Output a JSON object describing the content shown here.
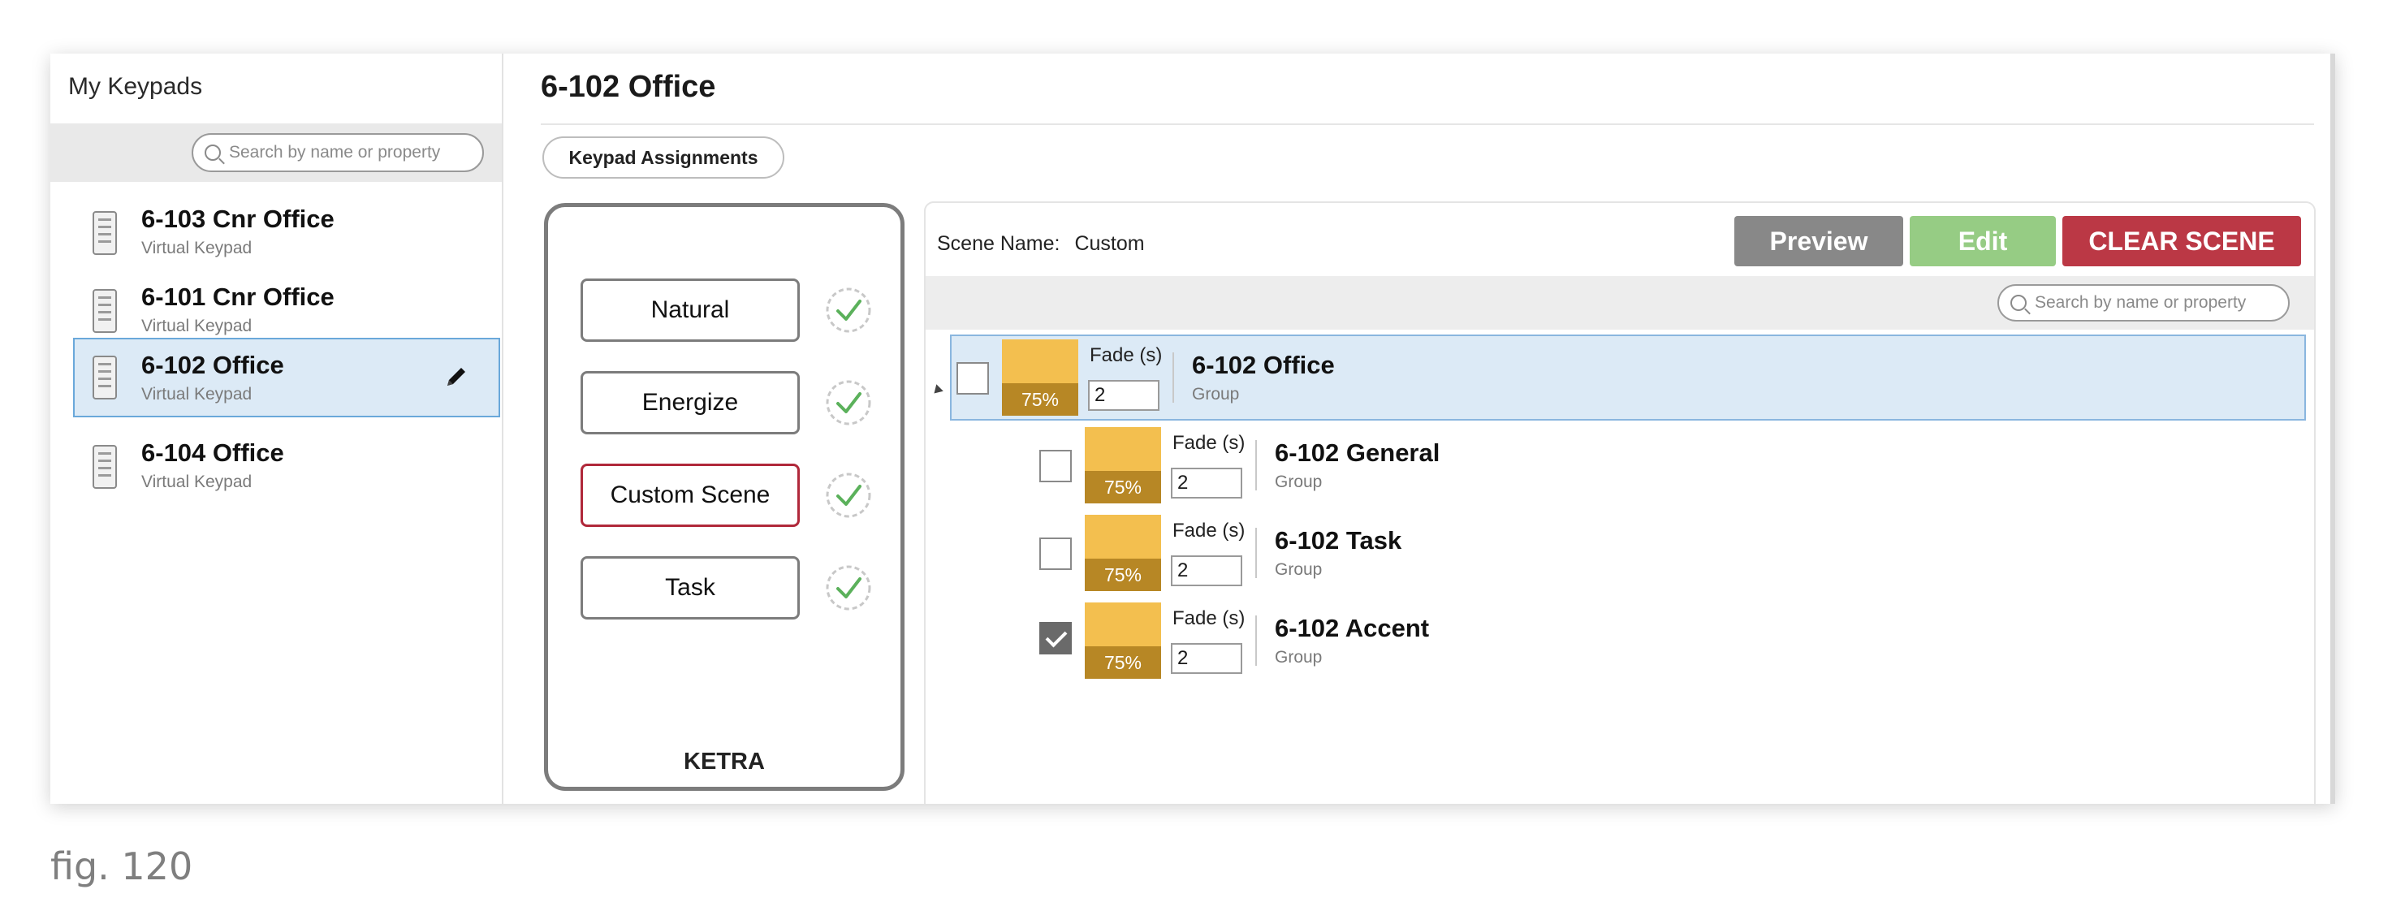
{
  "sidebar": {
    "title": "My Keypads",
    "search_placeholder": "Search by name or property",
    "items": [
      {
        "name": "6-103 Cnr Office",
        "type": "Virtual Keypad"
      },
      {
        "name": "6-101 Cnr Office",
        "type": "Virtual Keypad"
      },
      {
        "name": "6-102 Office",
        "type": "Virtual Keypad"
      },
      {
        "name": "6-104 Office",
        "type": "Virtual Keypad"
      }
    ]
  },
  "main": {
    "title": "6-102 Office",
    "assignments_button": "Keypad Assignments"
  },
  "keypad": {
    "buttons": [
      "Natural",
      "Energize",
      "Custom Scene",
      "Task"
    ],
    "brand": "KETRA"
  },
  "scene": {
    "name_label": "Scene Name:",
    "name_value": "Custom",
    "preview_label": "Preview",
    "edit_label": "Edit",
    "clear_label": "CLEAR SCENE",
    "search_placeholder": "Search by name or property",
    "groups": [
      {
        "name": "6-102 Office",
        "type": "Group",
        "level": "75%",
        "fade_label": "Fade (s)",
        "fade": "2",
        "checked": false
      },
      {
        "name": "6-102 General",
        "type": "Group",
        "level": "75%",
        "fade_label": "Fade (s)",
        "fade": "2",
        "checked": false
      },
      {
        "name": "6-102 Task",
        "type": "Group",
        "level": "75%",
        "fade_label": "Fade (s)",
        "fade": "2",
        "checked": false
      },
      {
        "name": "6-102 Accent",
        "type": "Group",
        "level": "75%",
        "fade_label": "Fade (s)",
        "fade": "2",
        "checked": true
      }
    ]
  },
  "colors": {
    "selection": "#dceaf6",
    "preview": "#888888",
    "edit": "#96cc84",
    "clear": "#bb3845",
    "swatch": "#f3bf4f",
    "swatch_dark": "#b78725",
    "active_border": "#b0283a"
  },
  "caption": "fig. 120"
}
